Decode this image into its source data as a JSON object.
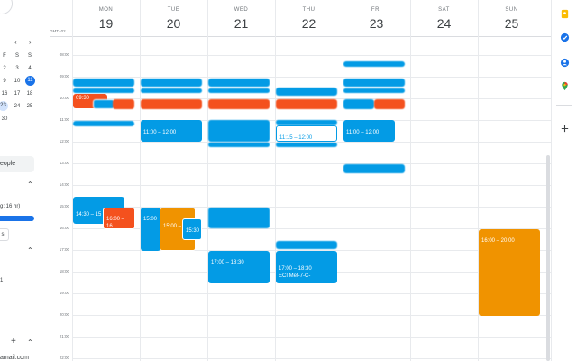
{
  "mini_calendar": {
    "prev": "‹",
    "next": "›",
    "dow": [
      "F",
      "S",
      "S"
    ],
    "rows": [
      [
        "2",
        "3",
        "4"
      ],
      [
        "9",
        "10",
        "11"
      ],
      [
        "16",
        "17",
        "18"
      ],
      [
        "23",
        "24",
        "25"
      ],
      [
        "30",
        "",
        ""
      ]
    ]
  },
  "sidebar": {
    "search_people": "eople",
    "working_hours_snip": "g: 16 hr)",
    "small_btn": "s",
    "cal_item": "1",
    "email_snip": "amail.com",
    "add": "+"
  },
  "timezone": "GMT+02",
  "days": [
    {
      "name": "MON",
      "num": "19"
    },
    {
      "name": "TUE",
      "num": "20"
    },
    {
      "name": "WED",
      "num": "21"
    },
    {
      "name": "THU",
      "num": "22"
    },
    {
      "name": "FRI",
      "num": "23"
    },
    {
      "name": "SAT",
      "num": "24"
    },
    {
      "name": "SUN",
      "num": "25"
    }
  ],
  "hours": [
    "08:00",
    "09:00",
    "10:00",
    "11:00",
    "12:00",
    "13:00",
    "14:00",
    "15:00",
    "16:00",
    "17:00",
    "18:00",
    "19:00",
    "20:00",
    "21:00",
    "22:00"
  ],
  "events": {
    "mon_0930": "09:30",
    "mon_1430": "14:30 – 15",
    "mon_1600": "16:00 – 16",
    "tue_1100": "11:00 – 12:00",
    "tue_1500a": "15:00",
    "tue_1500b": "15:00 –",
    "tue_1530": "15:30",
    "wed_1700": "17:00 – 18:30",
    "thu_1115": "11:15 – 12:00",
    "thu_1700": "17:00 – 18:30",
    "thu_1700_sub": "ECI Met-7-C-",
    "fri_1100": "11:00 – 12:00",
    "sun_1600": "16:00 – 20:00"
  },
  "colors": {
    "blue": "#039be5",
    "orange": "#f4511e",
    "amber": "#f09300",
    "today": "#1a73e8"
  },
  "rail_icons": [
    "keep-icon",
    "tasks-icon",
    "contacts-icon",
    "maps-icon",
    "add-icon"
  ]
}
